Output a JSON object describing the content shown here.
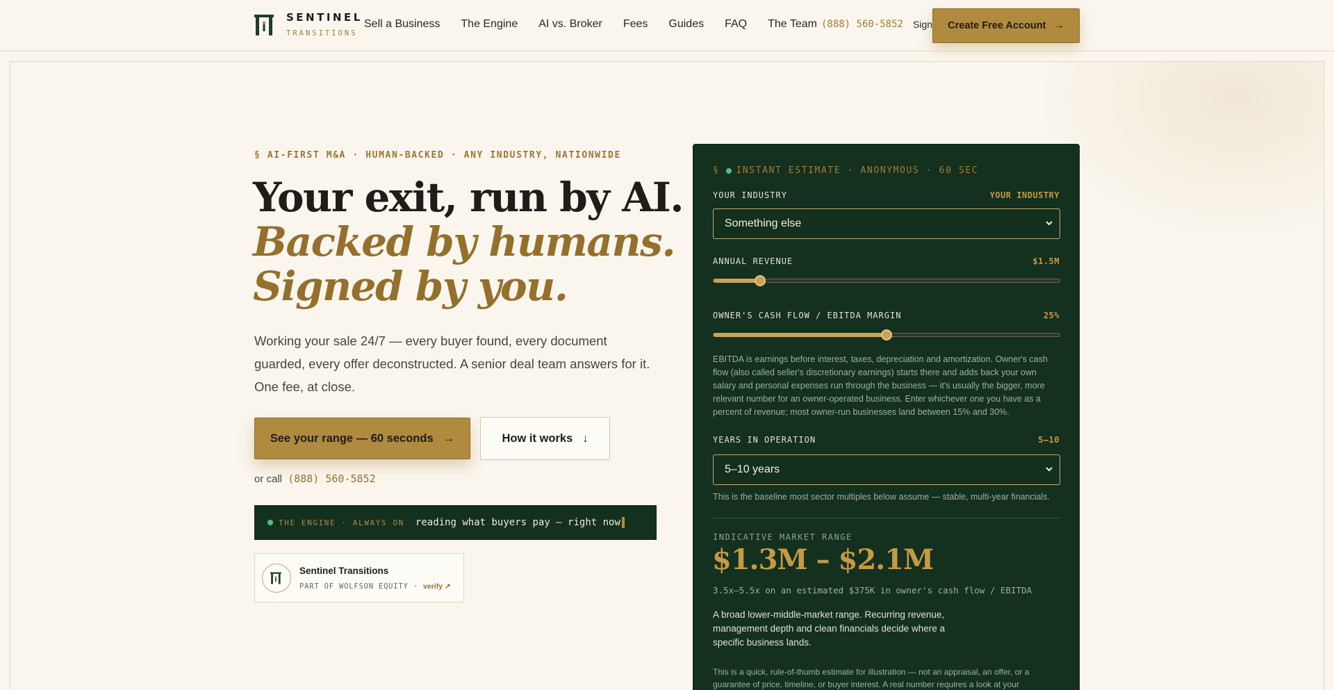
{
  "brand": {
    "name": "SENTINEL",
    "sub": "TRANSITIONS"
  },
  "nav": {
    "items": [
      "Sell a Business",
      "The Engine",
      "AI vs. Broker",
      "Fees",
      "Guides",
      "FAQ",
      "The Team"
    ],
    "phone": "(888) 560-5852",
    "signin": "Sign in",
    "cta": "Create Free Account",
    "cta_arrow": "→"
  },
  "hero": {
    "eyebrow": "§ AI-FIRST M&A · HUMAN-BACKED · ANY INDUSTRY, NATIONWIDE",
    "line1": "Your exit, run by AI.",
    "line2": "Backed by humans.",
    "line3": "Signed by you.",
    "lede": "Working your sale 24/7 — every buyer found, every document guarded, every offer deconstructed. A senior deal team answers for it. One fee, at close.",
    "primary_cta": "See your range — 60 seconds",
    "primary_arrow": "→",
    "secondary_cta": "How it works",
    "secondary_arrow": "↓",
    "orcall": "or call",
    "phone": "(888) 560-5852",
    "engine_label": "THE ENGINE · ALWAYS ON",
    "engine_text": "reading what buyers pay — right now",
    "badge_name": "Sentinel Transitions",
    "badge_sub": "PART OF WOLFSON EQUITY ·",
    "badge_verify": "verify ↗"
  },
  "estimator": {
    "eyebrow_prefix": "§",
    "eyebrow": "INSTANT ESTIMATE · ANONYMOUS · 60 SEC",
    "industry_label": "YOUR INDUSTRY",
    "industry_value": "YOUR INDUSTRY",
    "industry_selected": "Something else",
    "revenue_label": "ANNUAL REVENUE",
    "revenue_value": "$1.5M",
    "revenue_fraction": 0.135,
    "margin_label": "OWNER'S CASH FLOW / EBITDA MARGIN",
    "margin_value": "25%",
    "margin_fraction": 0.5,
    "margin_help": "EBITDA is earnings before interest, taxes, depreciation and amortization. Owner's cash flow (also called seller's discretionary earnings) starts there and adds back your own salary and personal expenses run through the business — it's usually the bigger, more relevant number for an owner-operated business. Enter whichever one you have as a percent of revenue; most owner-run businesses land between 15% and 30%.",
    "years_label": "YEARS IN OPERATION",
    "years_value": "5–10",
    "years_selected": "5–10 years",
    "years_help": "This is the baseline most sector multiples below assume — stable, multi-year financials.",
    "range_label": "INDICATIVE MARKET RANGE",
    "range": "$1.3M – $2.1M",
    "multiple": "3.5x–5.5x on an estimated $375K in owner's cash flow / EBITDA",
    "range_desc": "A broad lower-middle-market range. Recurring revenue, management depth and clean financials decide where a specific business lands.",
    "disclaimer": "This is a quick, rule-of-thumb estimate for illustration — not an appraisal, an offer, or a guarantee of price, timeline, or buyer interest. A real number requires a look at your"
  },
  "colors": {
    "gold": "#b08a3e",
    "forest": "#14301f",
    "cream": "#faf6ee",
    "status_green": "#4fc27a"
  }
}
